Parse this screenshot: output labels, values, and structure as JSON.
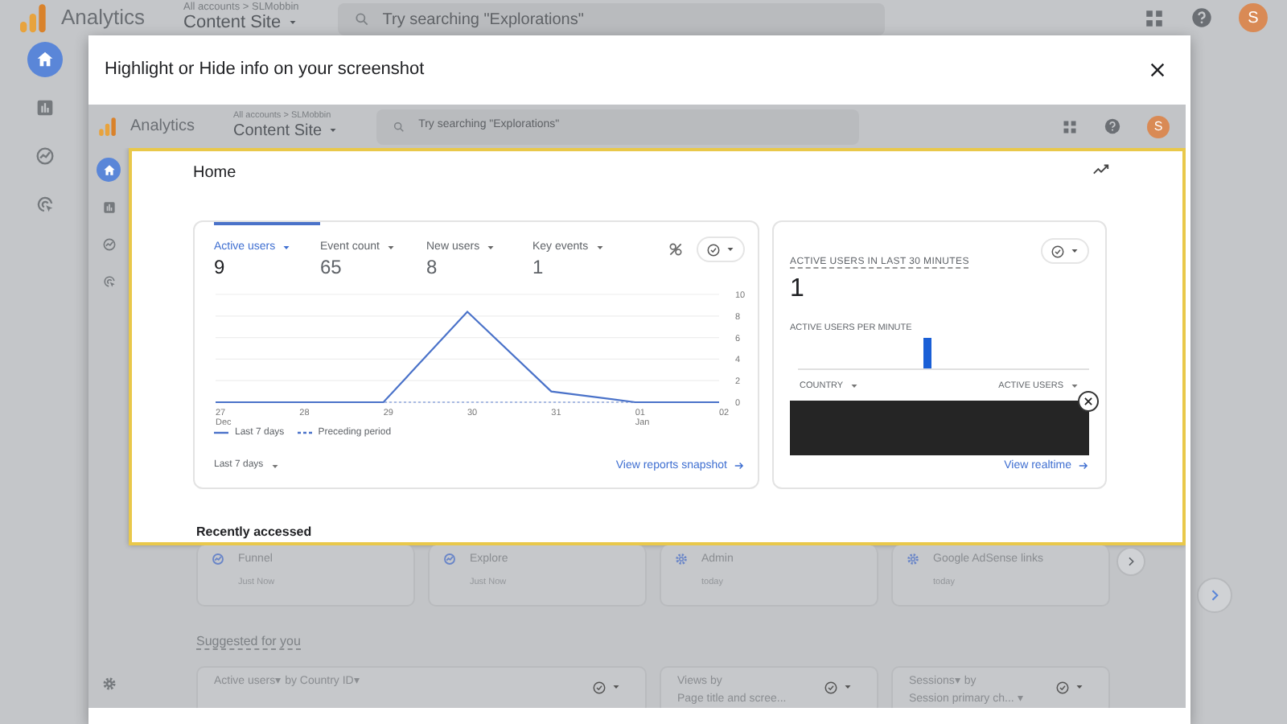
{
  "app": {
    "product": "Analytics",
    "breadcrumb": "All accounts > SLMobbin",
    "property": "Content Site",
    "search_placeholder": "Try searching \"Explorations\"",
    "avatar": "S",
    "nav": [
      {
        "kind": "home",
        "selected": true
      },
      {
        "kind": "reports",
        "selected": false
      },
      {
        "kind": "explore",
        "selected": false
      },
      {
        "kind": "advertising",
        "selected": false
      }
    ]
  },
  "dialog": {
    "title": "Highlight or Hide info on your screenshot",
    "screenshot": {
      "product": "Analytics",
      "breadcrumb": "All accounts > SLMobbin",
      "property": "Content Site",
      "search_placeholder": "Try searching \"Explorations\"",
      "avatar": "S",
      "nav": [
        {
          "kind": "home",
          "selected": true
        },
        {
          "kind": "reports",
          "selected": false
        },
        {
          "kind": "explore",
          "selected": false
        },
        {
          "kind": "advertising",
          "selected": false
        },
        {
          "kind": "settings",
          "selected": false
        }
      ],
      "home": {
        "title": "Home",
        "metrics": [
          {
            "label": "Active users",
            "value": "9",
            "selected": true
          },
          {
            "label": "Event count",
            "value": "65",
            "selected": false
          },
          {
            "label": "New users",
            "value": "8",
            "selected": false
          },
          {
            "label": "Key events",
            "value": "1",
            "selected": false
          }
        ],
        "chart_data": {
          "type": "line",
          "grid": true,
          "categories": [
            "27 Dec",
            "28",
            "29",
            "30",
            "31",
            "01 Jan",
            "02"
          ],
          "ylim": [
            0,
            10
          ],
          "yticks": [
            0,
            2,
            4,
            6,
            8,
            10
          ],
          "series": [
            {
              "name": "Last 7 days",
              "color": "#4a72c9",
              "line_style": "solid",
              "values": [
                0,
                0,
                0,
                8.4,
                1,
                0,
                0
              ]
            },
            {
              "name": "Preceding period",
              "color": "#4a72c9",
              "line_style": "dashed",
              "values": [
                0,
                0,
                0,
                0,
                0,
                0,
                0
              ]
            }
          ]
        },
        "date_range": "Last 7 days",
        "link": "View reports snapshot"
      },
      "realtime": {
        "title": "ACTIVE USERS IN LAST 30 MINUTES",
        "value": "1",
        "subtitle": "ACTIVE USERS PER MINUTE",
        "columns": [
          "COUNTRY",
          "ACTIVE USERS"
        ],
        "link": "View realtime"
      },
      "recently_accessed": {
        "title": "Recently accessed",
        "items": [
          {
            "kind": "explore",
            "name": "Funnel",
            "time": "Just Now"
          },
          {
            "kind": "explore",
            "name": "Explore",
            "time": "Just Now"
          },
          {
            "kind": "settings",
            "name": "Admin",
            "time": "today"
          },
          {
            "kind": "settings",
            "name": "Google AdSense links",
            "time": "today"
          }
        ]
      },
      "suggested": {
        "title": "Suggested for you",
        "cards": [
          {
            "lines": [
              "Active users▾ by Country ID▾"
            ]
          },
          {
            "lines": [
              "Views by",
              "Page title and scree..."
            ]
          },
          {
            "lines": [
              "Sessions▾ by",
              "Session primary ch... ▾"
            ]
          }
        ]
      }
    }
  }
}
